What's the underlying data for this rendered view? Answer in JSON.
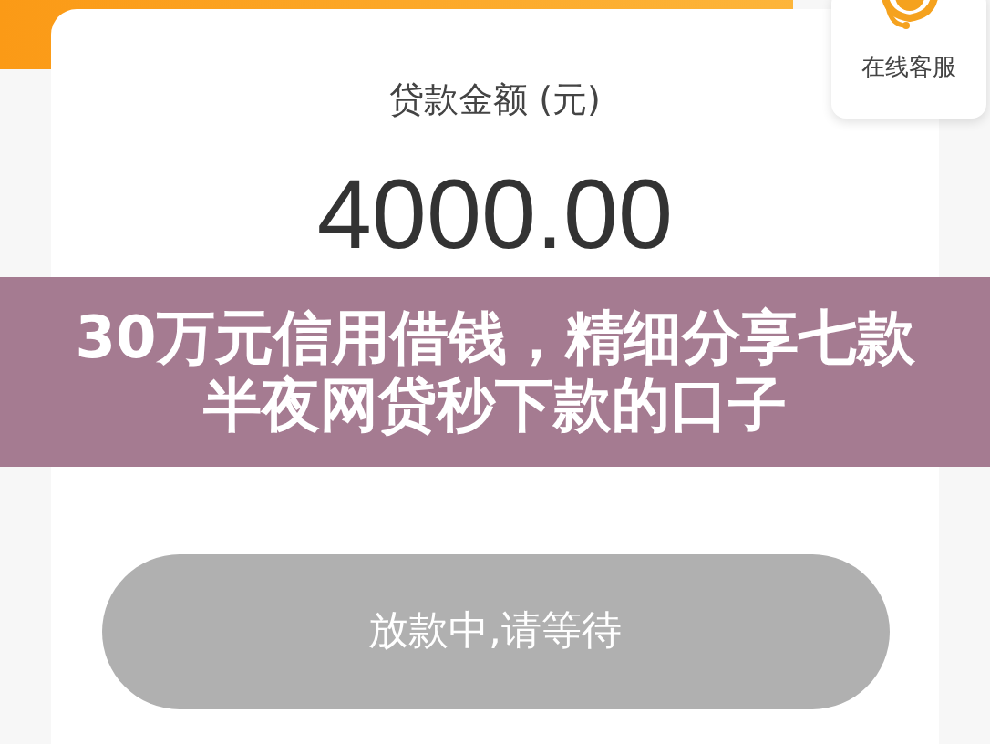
{
  "customer_service": {
    "label": "在线客服"
  },
  "loan": {
    "label": "贷款金额 (元)",
    "amount": "4000.00"
  },
  "banner": {
    "title": "30万元信用借钱，精细分享七款半夜网贷秒下款的口子"
  },
  "action_button": {
    "label": "放款中,请等待",
    "disabled": true
  }
}
